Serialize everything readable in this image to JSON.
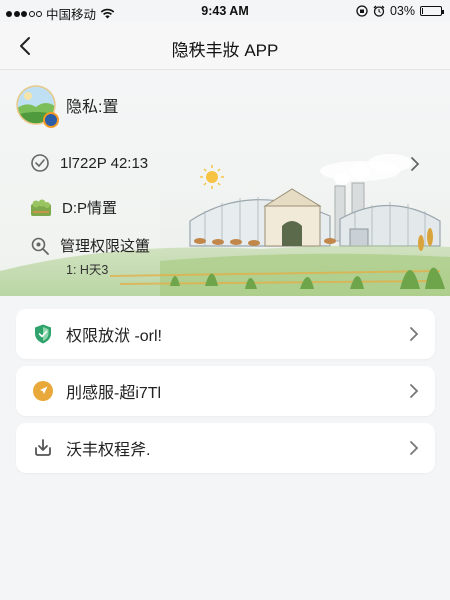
{
  "status_bar": {
    "carrier": "中国移动",
    "time": "9:43 AM",
    "battery": "03%",
    "battery_level": 0.03
  },
  "nav": {
    "title": "隐秩丰妝 APP",
    "back_icon": "chevron-left-icon"
  },
  "profile": {
    "name": "隐私:置",
    "avatar_icon": "landscape-avatar-icon"
  },
  "info_rows": [
    {
      "icon": "check-circle-icon",
      "text": "1l722P 42:13"
    },
    {
      "icon": "farm-icon",
      "text": "D:P情置"
    },
    {
      "icon": "search-icon",
      "text": "管理权限这簠",
      "sub": "1: H天3"
    }
  ],
  "menu": [
    {
      "icon": "shield-icon",
      "label": "权限放洑 -orl!",
      "color": "#2fa36b"
    },
    {
      "icon": "navigation-icon",
      "label": "刖感服-超i7Tl",
      "color": "#e8a93a"
    },
    {
      "icon": "download-icon",
      "label": "沃丰权程斧.",
      "color": "#555555"
    }
  ],
  "colors": {
    "background": "#f4f5f6",
    "card": "#ffffff",
    "accent_green": "#2fa36b",
    "accent_orange": "#e8a93a"
  }
}
